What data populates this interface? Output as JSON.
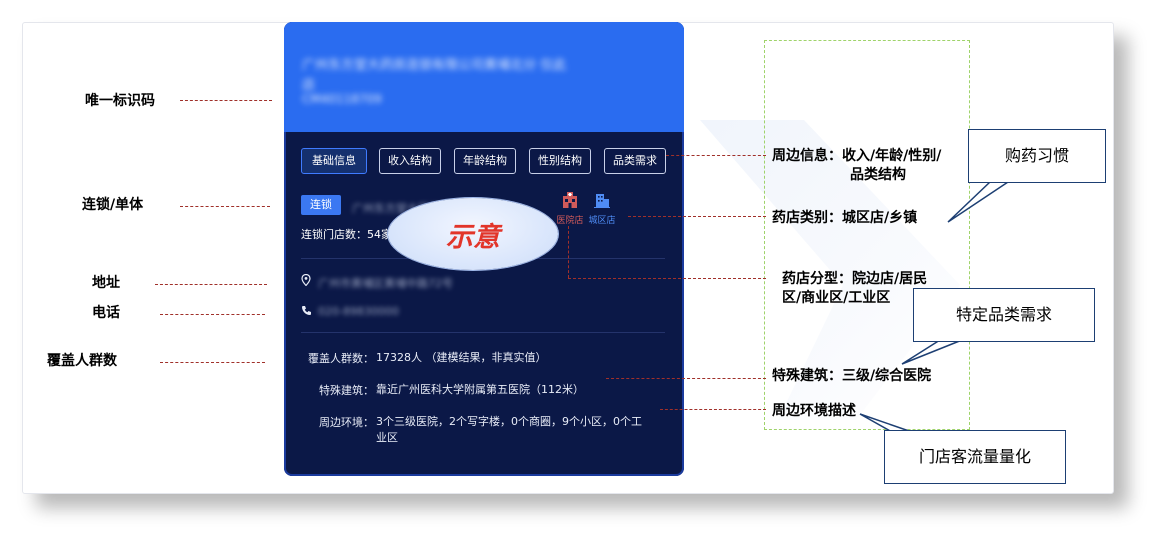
{
  "left_labels": {
    "unique_id": "唯一标识码",
    "chain_single": "连锁/单体",
    "address": "地址",
    "phone": "电话",
    "coverage": "覆盖人群数"
  },
  "card": {
    "head_line1": "广州东方堂大药房连锁有限公司黄埔北分   仅此",
    "head_line2": "店",
    "head_line3": "CM40118709",
    "tabs": [
      "基础信息",
      "收入结构",
      "年龄结构",
      "性别结构",
      "品类需求"
    ],
    "chain_badge": "连锁",
    "chain_name_blur": "广州东方堂大药房连锁有",
    "store_count_label": "连锁门店数：54家",
    "icon_hospital_label": "医院店",
    "icon_city_label": "城区店",
    "address_blur": "广州市黄埔区黄埔中路72号",
    "phone_blur": "020-89830000",
    "coverage_label": "覆盖人群数：",
    "coverage_value": "17328人 （建模结果，非真实值）",
    "special_label": "特殊建筑：",
    "special_value": "靠近广州医科大学附属第五医院（112米）",
    "env_label": "周边环境：",
    "env_value_line1": "3个三级医院，2个写字楼，0个商圈，9个小区，0个工",
    "env_value_line2": "业区"
  },
  "oval_text": "示意",
  "right_labels": {
    "surrounding_info_l1": "周边信息：收入/年龄/性别/",
    "surrounding_info_l2": "品类结构",
    "store_category": "药店类别：城区店/乡镇",
    "store_subtype_l1": "药店分型：院边店/居民",
    "store_subtype_l2": "区/商业区/工业区",
    "special_building": "特殊建筑：三级/综合医院",
    "env_desc": "周边环境描述"
  },
  "callouts": {
    "habit": "购药习惯",
    "category_demand": "特定品类需求",
    "traffic": "门店客流量量化"
  },
  "colors": {
    "card_bg": "#0b1847",
    "header_blue": "#2a6cf0",
    "accent_red": "#e2352a",
    "dash_red": "#a0302a",
    "green_dash": "#9fd36a"
  }
}
